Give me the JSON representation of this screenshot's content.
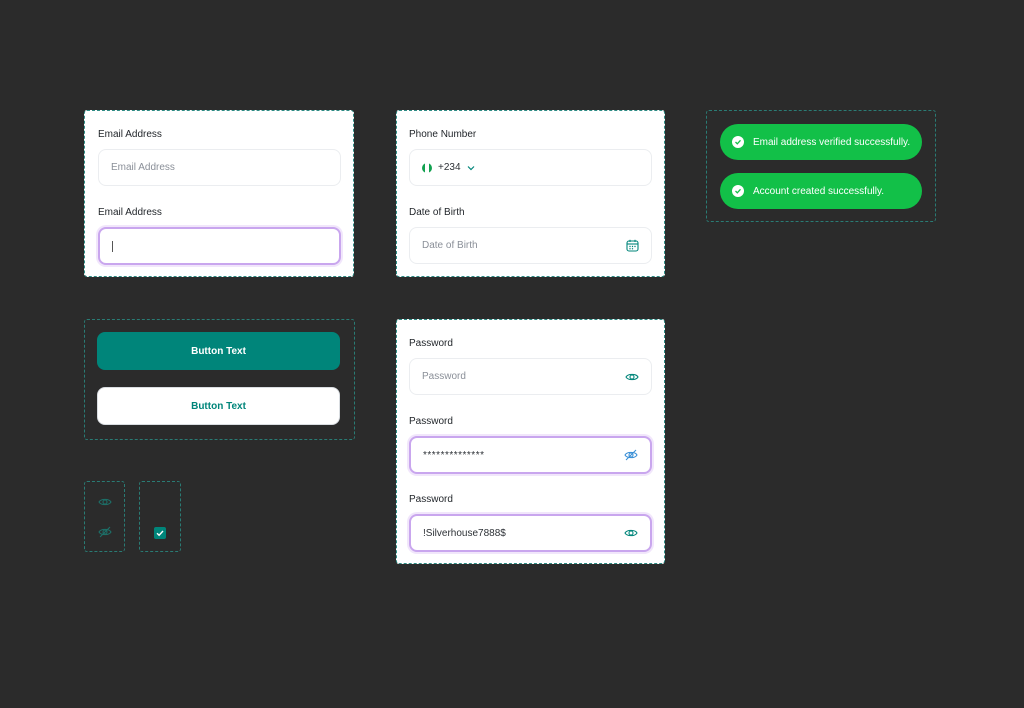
{
  "email_card": {
    "field1_label": "Email Address",
    "field1_placeholder": "Email Address",
    "field2_label": "Email Address",
    "field2_value": ""
  },
  "phone_card": {
    "phone_label": "Phone Number",
    "country_code": "+234",
    "dob_label": "Date of Birth",
    "dob_placeholder": "Date of Birth"
  },
  "toasts": {
    "verified": "Email address verified successfully.",
    "created": "Account created successfully."
  },
  "buttons": {
    "primary_label": "Button Text",
    "secondary_label": "Button Text"
  },
  "password_card": {
    "label1": "Password",
    "placeholder1": "Password",
    "label2": "Password",
    "masked_value": "**************",
    "label3": "Password",
    "revealed_value": "!Silverhouse7888$"
  },
  "colors": {
    "accent": "#00857a",
    "success": "#12c048",
    "focus_ring": "#c9a6ee",
    "background": "#2b2b2b"
  },
  "icons": [
    "eye-icon",
    "eye-off-icon",
    "checkbox-checked-icon",
    "calendar-icon",
    "chevron-down-icon",
    "nigeria-flag-icon",
    "check-circle-icon"
  ]
}
